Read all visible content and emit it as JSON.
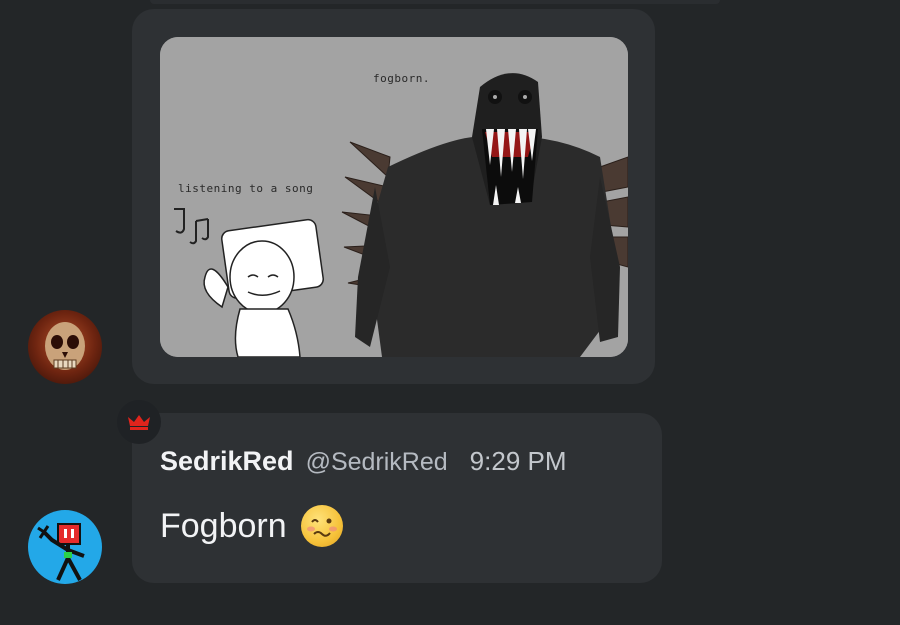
{
  "image_post": {
    "meme_labels": {
      "monster": "fogborn.",
      "kid": "listening to a song"
    }
  },
  "message": {
    "username": "SedrikRed",
    "handle": "@SedrikRed",
    "timestamp": "9:29 PM",
    "text": "Fogborn",
    "emoji": "woozy-face-emoji",
    "role_badge": "crown-icon"
  },
  "colors": {
    "background": "#232628",
    "bubble": "#2e3134",
    "crown": "#e0241c",
    "robot_avatar": "#23a8e8"
  }
}
